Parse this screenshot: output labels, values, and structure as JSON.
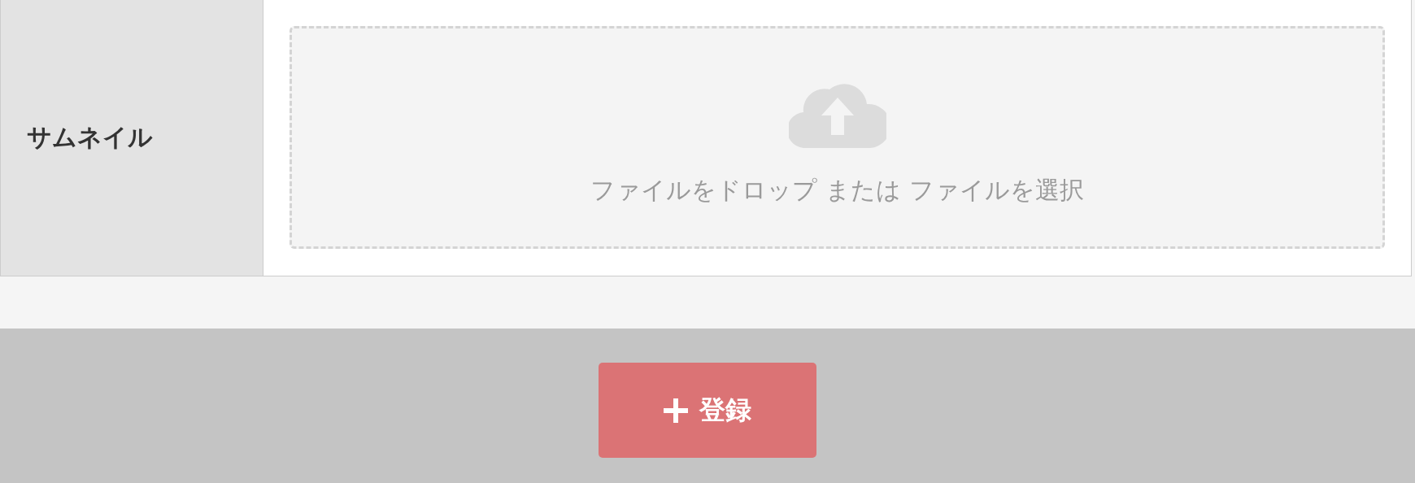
{
  "form": {
    "rows": [
      {
        "label": "サムネイル",
        "kind": "file-drop",
        "hint": "ファイルをドロップ または ファイルを選択"
      }
    ]
  },
  "submit_button": {
    "label": "登録"
  }
}
